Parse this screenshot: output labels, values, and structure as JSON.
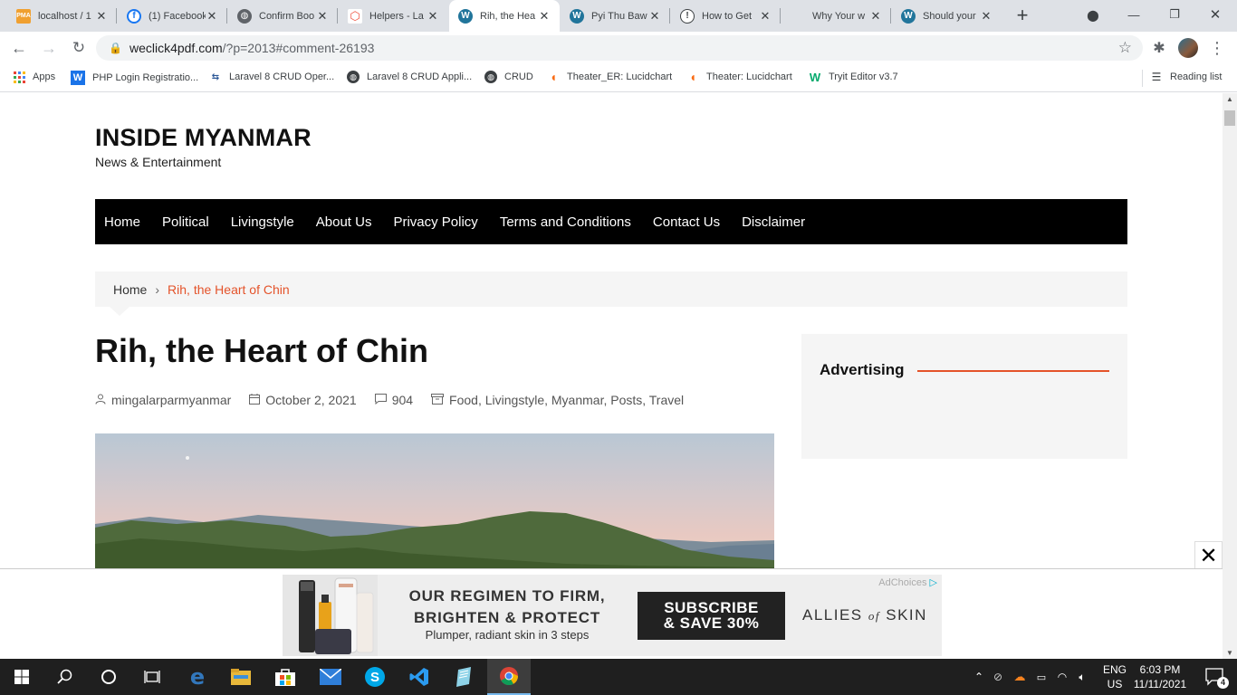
{
  "browser": {
    "tabs": [
      {
        "title": "localhost / 1",
        "icon": "phpmyadmin-icon",
        "color": "#f0a030"
      },
      {
        "title": "(1) Facebook",
        "icon": "facebook-icon",
        "color": "#1877f2"
      },
      {
        "title": "Confirm Boo",
        "icon": "globe-icon",
        "color": "#5f6368"
      },
      {
        "title": "Helpers - La",
        "icon": "laravel-icon",
        "color": "#f05340"
      },
      {
        "title": "Rih, the Hea",
        "icon": "wordpress-icon",
        "color": "#21759b",
        "active": true
      },
      {
        "title": "Pyi Thu Baw",
        "icon": "wordpress-icon",
        "color": "#21759b"
      },
      {
        "title": "How to Get",
        "icon": "info-icon",
        "color": "#5f6368"
      },
      {
        "title": "Why Your w",
        "icon": "blank-icon",
        "color": "#dee1e6"
      },
      {
        "title": "Should your",
        "icon": "wordpress-icon",
        "color": "#21759b"
      }
    ],
    "new_tab": "+",
    "window_controls": {
      "minimize": "—",
      "restore": "❐",
      "close": "✕"
    },
    "url_host": "weclick4pdf.com",
    "url_path": "/?p=2013#comment-26193",
    "bookmarks": [
      {
        "label": "Apps",
        "icon": "apps-grid-icon",
        "color": "#ea4335"
      },
      {
        "label": "PHP Login Registratio...",
        "icon": "w3schools-icon",
        "color": "#1a73e8"
      },
      {
        "label": "Laravel 8 CRUD Oper...",
        "icon": "tutorial-icon",
        "color": "#2b5797"
      },
      {
        "label": "Laravel 8 CRUD Appli...",
        "icon": "globe-icon",
        "color": "#3c4043"
      },
      {
        "label": "CRUD",
        "icon": "globe-icon",
        "color": "#3c4043"
      },
      {
        "label": "Theater_ER: Lucidchart",
        "icon": "lucidchart-icon",
        "color": "#f96b13"
      },
      {
        "label": "Theater: Lucidchart",
        "icon": "lucidchart-icon",
        "color": "#f96b13"
      },
      {
        "label": "Tryit Editor v3.7",
        "icon": "w3schools-icon",
        "color": "#04aa6d"
      }
    ],
    "reading_list": "Reading list"
  },
  "site": {
    "title": "INSIDE MYANMAR",
    "tagline": "News & Entertainment",
    "nav": [
      "Home",
      "Political",
      "Livingstyle",
      "About Us",
      "Privacy Policy",
      "Terms and Conditions",
      "Contact Us",
      "Disclaimer"
    ],
    "accent": "#e4532a"
  },
  "breadcrumb": {
    "home": "Home",
    "separator": "›",
    "current": "Rih, the Heart of Chin"
  },
  "post": {
    "title": "Rih, the Heart of Chin",
    "author": "mingalarparmyanmar",
    "date": "October 2, 2021",
    "comments": "904",
    "categories": "Food, Livingstyle, Myanmar, Posts, Travel"
  },
  "sidebar": {
    "widget_title": "Advertising"
  },
  "ad": {
    "headline_1": "OUR REGIMEN TO FIRM,",
    "headline_2": "BRIGHTEN & PROTECT",
    "subline": "Plumper, radiant skin in 3 steps",
    "cta_1": "SUBSCRIBE",
    "cta_2": "& SAVE 30%",
    "brand_a": "ALLIES",
    "brand_of": "of",
    "brand_b": "SKIN",
    "adchoices": "AdChoices",
    "close": "✕"
  },
  "taskbar": {
    "apps": [
      "start-icon",
      "search-icon",
      "cortana-icon",
      "task-view-icon",
      "edge-icon",
      "file-explorer-icon",
      "store-icon",
      "mail-icon",
      "skype-icon",
      "vscode-icon",
      "notepad-icon",
      "chrome-icon"
    ],
    "lang_1": "ENG",
    "lang_2": "US",
    "time": "6:03 PM",
    "date": "11/11/2021",
    "notifications": "4"
  }
}
